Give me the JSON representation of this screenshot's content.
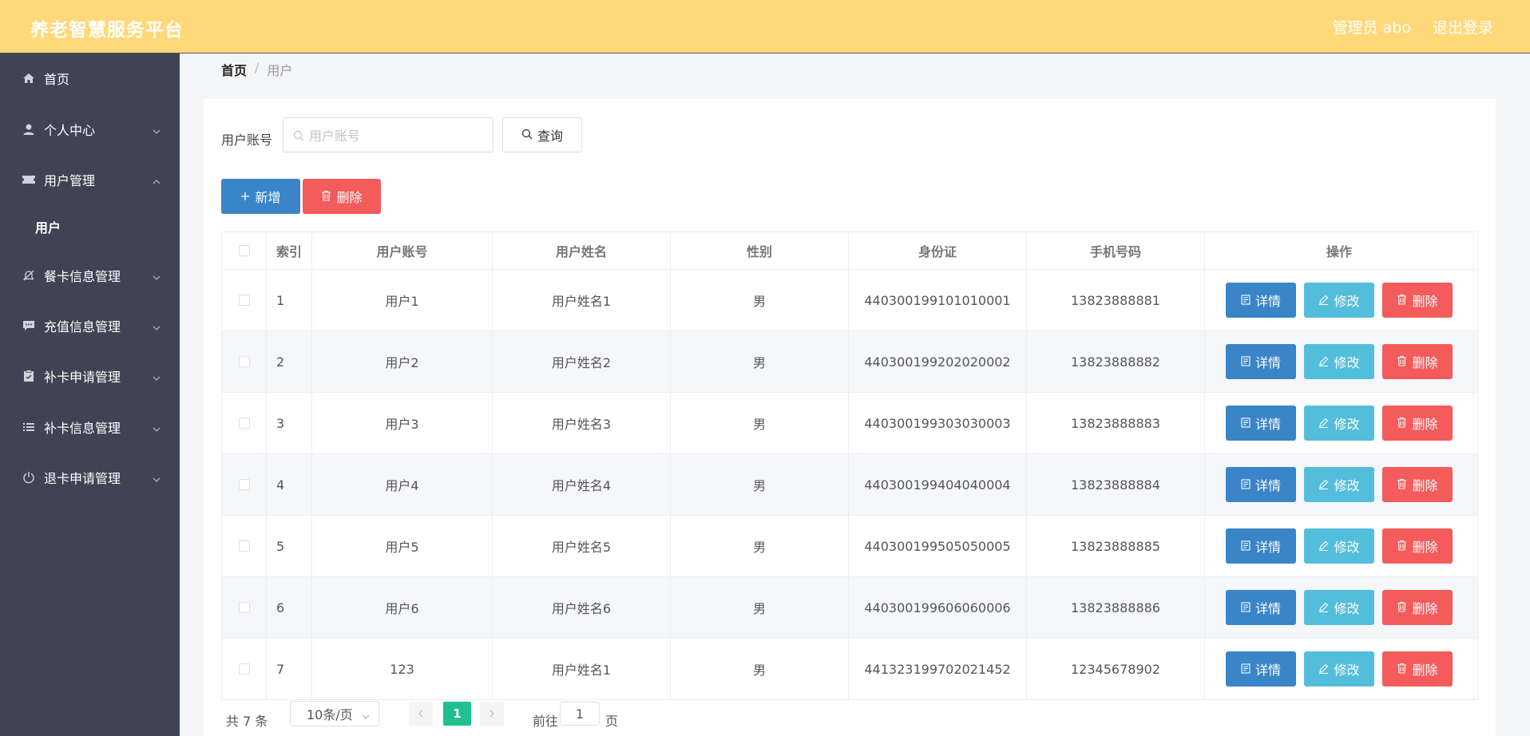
{
  "header": {
    "title": "养老智慧服务平台",
    "user": "管理员 abo",
    "logout": "退出登录"
  },
  "sidebar": {
    "items": [
      {
        "label": "首页",
        "icon": "home-icon"
      },
      {
        "label": "个人中心",
        "icon": "person-icon"
      },
      {
        "label": "用户管理",
        "icon": "ticket-icon"
      },
      {
        "label": "餐卡信息管理",
        "icon": "bell-off-icon"
      },
      {
        "label": "充值信息管理",
        "icon": "chat-icon"
      },
      {
        "label": "补卡申请管理",
        "icon": "clipboard-icon"
      },
      {
        "label": "补卡信息管理",
        "icon": "list-icon"
      },
      {
        "label": "退卡申请管理",
        "icon": "power-icon"
      }
    ],
    "sub": {
      "label": "用户"
    }
  },
  "breadcrumb": {
    "home": "首页",
    "sep": "/",
    "current": "用户"
  },
  "search": {
    "label": "用户账号",
    "placeholder": "用户账号",
    "value": "",
    "button": "查询"
  },
  "actions": {
    "add": "新增",
    "delete": "删除"
  },
  "table": {
    "headers": [
      "索引",
      "用户账号",
      "用户姓名",
      "性别",
      "身份证",
      "手机号码",
      "操作"
    ],
    "rows": [
      {
        "idx": "1",
        "account": "用户1",
        "name": "用户姓名1",
        "gender": "男",
        "id_card": "440300199101010001",
        "phone": "13823888881"
      },
      {
        "idx": "2",
        "account": "用户2",
        "name": "用户姓名2",
        "gender": "男",
        "id_card": "440300199202020002",
        "phone": "13823888882"
      },
      {
        "idx": "3",
        "account": "用户3",
        "name": "用户姓名3",
        "gender": "男",
        "id_card": "440300199303030003",
        "phone": "13823888883"
      },
      {
        "idx": "4",
        "account": "用户4",
        "name": "用户姓名4",
        "gender": "男",
        "id_card": "440300199404040004",
        "phone": "13823888884"
      },
      {
        "idx": "5",
        "account": "用户5",
        "name": "用户姓名5",
        "gender": "男",
        "id_card": "440300199505050005",
        "phone": "13823888885"
      },
      {
        "idx": "6",
        "account": "用户6",
        "name": "用户姓名6",
        "gender": "男",
        "id_card": "440300199606060006",
        "phone": "13823888886"
      },
      {
        "idx": "7",
        "account": "123",
        "name": "用户姓名1",
        "gender": "男",
        "id_card": "441323199702021452",
        "phone": "12345678902"
      }
    ],
    "ops": {
      "detail": "详情",
      "edit": "修改",
      "remove": "删除"
    }
  },
  "pagination": {
    "total": "共 7 条",
    "page_size": "10条/页",
    "current": "1",
    "goto_label": "前往",
    "goto_value": "1",
    "page_unit": "页"
  },
  "colors": {
    "header_bg": "#ffd87a",
    "sidebar_bg": "#3e4454",
    "primary": "#3a85c7",
    "info": "#53bedc",
    "danger": "#f45b5b",
    "active_page": "#1fbf8f"
  }
}
